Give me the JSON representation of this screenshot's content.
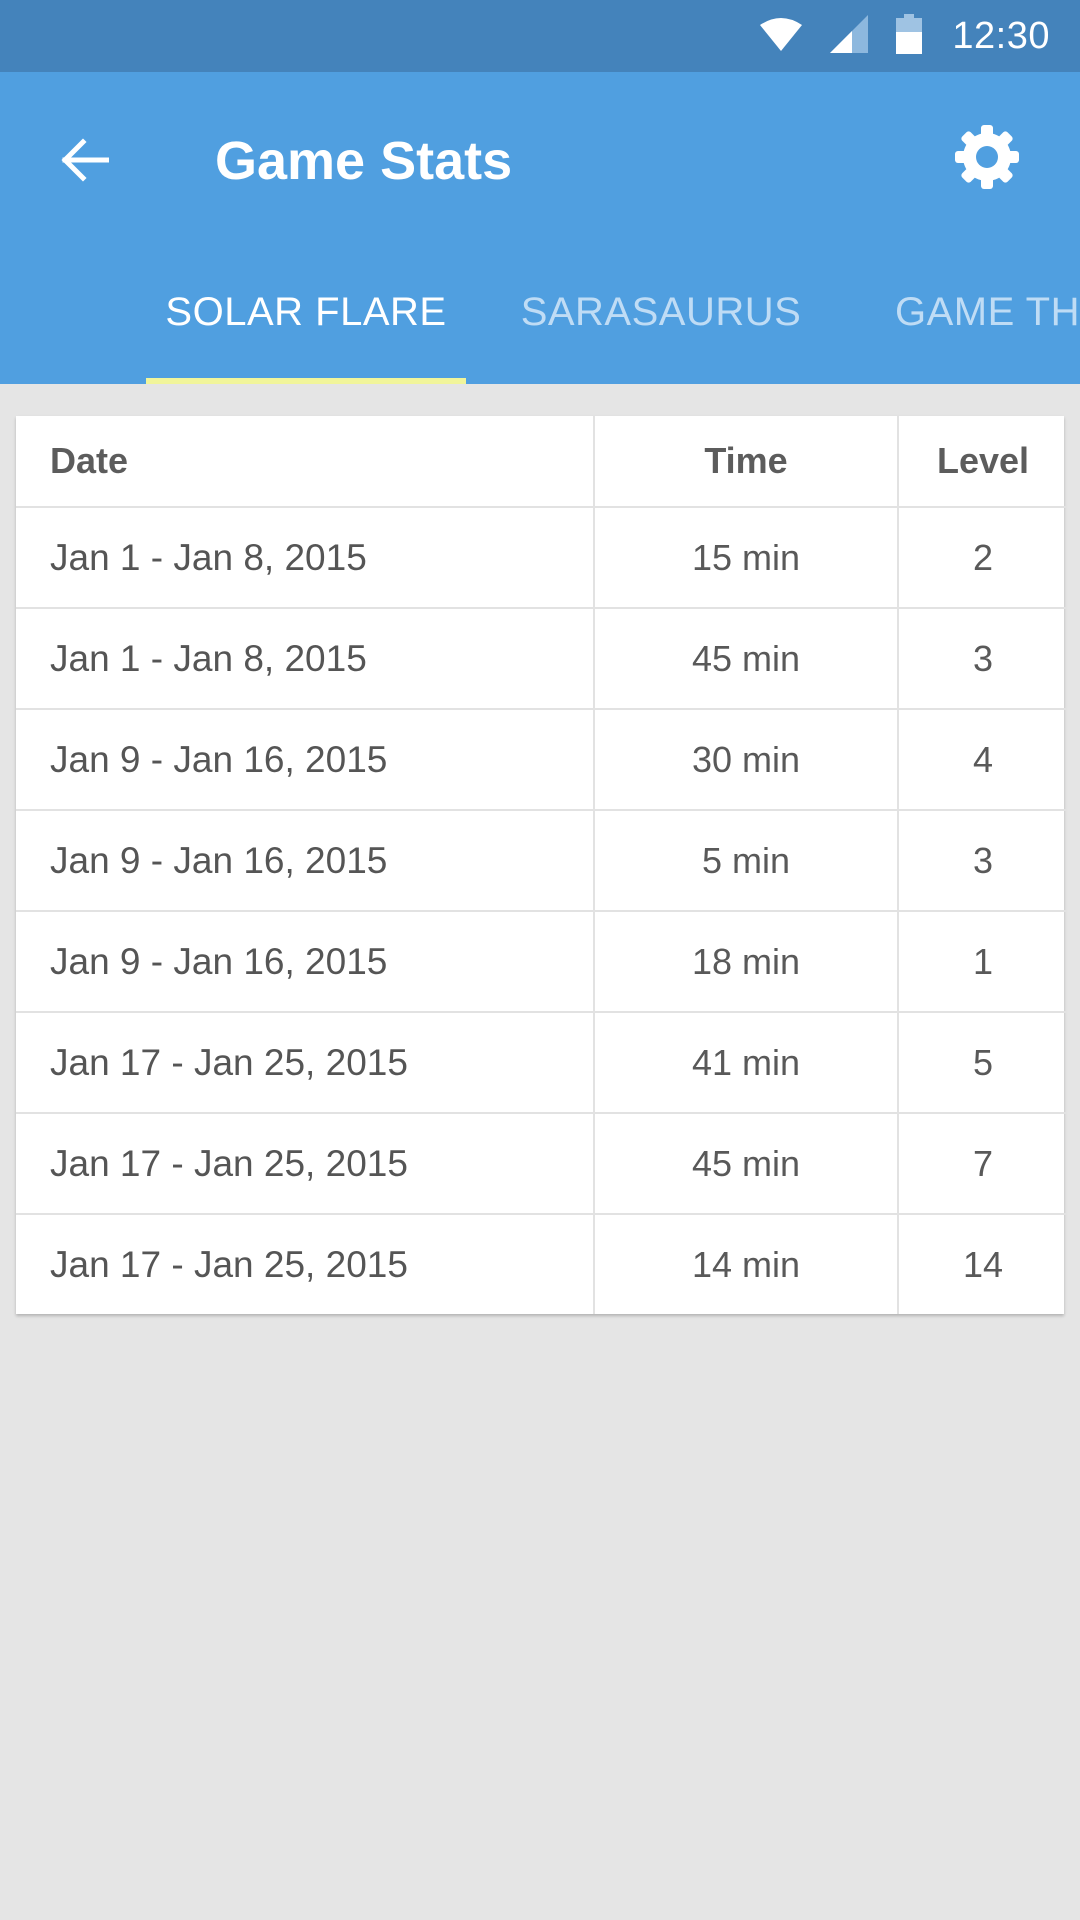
{
  "status_bar": {
    "time": "12:30"
  },
  "app_bar": {
    "title": "Game Stats"
  },
  "tabs": [
    {
      "label": "SOLAR FLARE",
      "active": true
    },
    {
      "label": "SARASAURUS",
      "active": false
    },
    {
      "label": "GAME TH",
      "active": false
    }
  ],
  "table": {
    "headers": {
      "date": "Date",
      "time": "Time",
      "level": "Level"
    },
    "rows": [
      {
        "date": "Jan 1 - Jan 8, 2015",
        "time": "15 min",
        "level": "2"
      },
      {
        "date": "Jan 1 - Jan 8, 2015",
        "time": "45 min",
        "level": "3"
      },
      {
        "date": "Jan 9 - Jan 16, 2015",
        "time": "30 min",
        "level": "4"
      },
      {
        "date": "Jan 9 - Jan 16, 2015",
        "time": "5 min",
        "level": "3"
      },
      {
        "date": "Jan 9 - Jan 16, 2015",
        "time": "18 min",
        "level": "1"
      },
      {
        "date": "Jan 17 - Jan 25, 2015",
        "time": "41 min",
        "level": "5"
      },
      {
        "date": "Jan 17 - Jan 25, 2015",
        "time": "45 min",
        "level": "7"
      },
      {
        "date": "Jan 17 - Jan 25, 2015",
        "time": "14 min",
        "level": "14"
      }
    ]
  },
  "colors": {
    "status_bar": "#4483bb",
    "app_bar": "#509fe0",
    "tab_indicator": "#f1f59b",
    "background": "#e5e5e5"
  },
  "icons": {
    "wifi": "wifi-icon",
    "signal": "cell-signal-icon",
    "battery": "battery-icon",
    "back": "arrow-back-icon",
    "settings": "gear-icon"
  }
}
